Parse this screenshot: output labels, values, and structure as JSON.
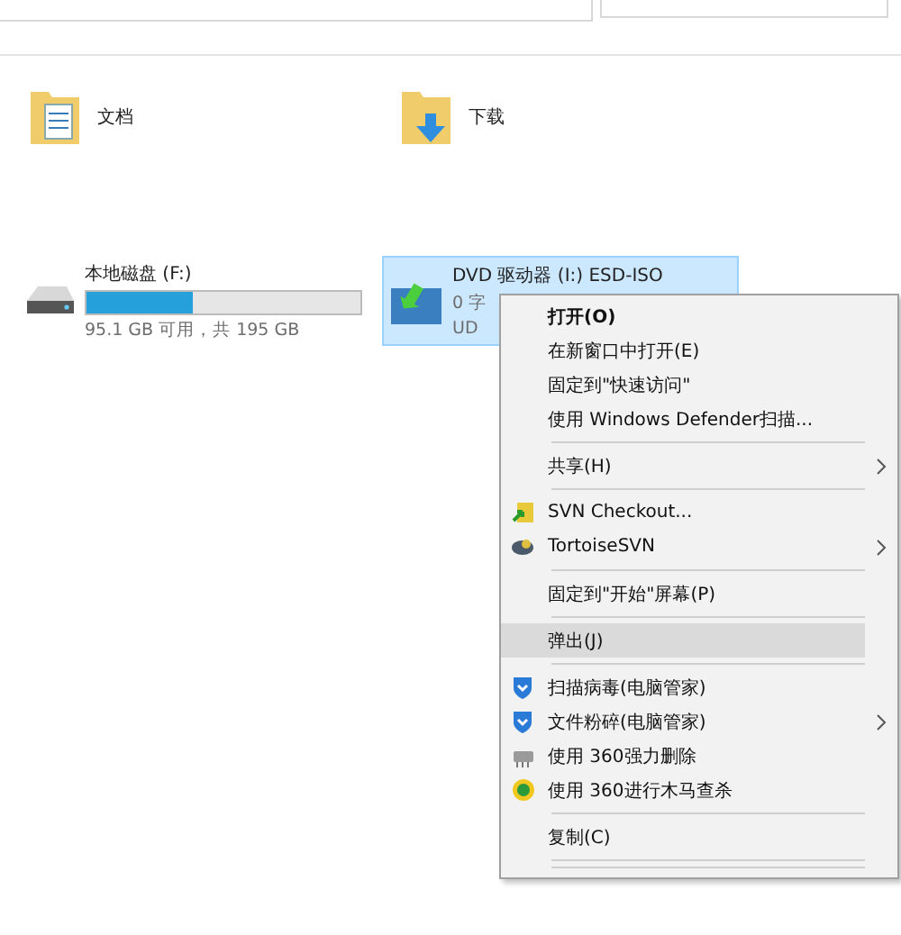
{
  "folders": [
    {
      "name": "文档",
      "kind": "documents"
    },
    {
      "name": "下载",
      "kind": "downloads"
    }
  ],
  "drives": [
    {
      "kind": "disk",
      "name": "本地磁盘 (F:)",
      "level": 0.39,
      "info": "95.1 GB 可用，共 195 GB",
      "selected": false
    },
    {
      "kind": "dvd",
      "name": "DVD 驱动器 (I:) ESD-ISO",
      "info": "0 字",
      "extra": "UD",
      "selected": true
    }
  ],
  "context_menu": [
    {
      "kind": "item",
      "label": "打开(O)",
      "bold": true,
      "selected": false
    },
    {
      "kind": "item",
      "label": "在新窗口中打开(E)",
      "selected": false
    },
    {
      "kind": "item",
      "label": "固定到\"快速访问\"",
      "selected": false
    },
    {
      "kind": "item",
      "label": "使用 Windows Defender扫描...",
      "selected": false
    },
    {
      "kind": "separator"
    },
    {
      "kind": "item",
      "label": "共享(H)",
      "submenu": true,
      "selected": false
    },
    {
      "kind": "separator"
    },
    {
      "kind": "svn",
      "label": "SVN Checkout...",
      "selected": false
    },
    {
      "kind": "tortoise",
      "label": "TortoiseSVN",
      "submenu": true,
      "selected": false
    },
    {
      "kind": "separator"
    },
    {
      "kind": "item",
      "label": "固定到\"开始\"屏幕(P)",
      "selected": false
    },
    {
      "kind": "separator"
    },
    {
      "kind": "item",
      "label": "弹出(J)",
      "selected": true
    },
    {
      "kind": "separator"
    },
    {
      "kind": "shield",
      "label": "扫描病毒(电脑管家)",
      "selected": false
    },
    {
      "kind": "shield",
      "label": "文件粉碎(电脑管家)",
      "submenu": true,
      "selected": false
    },
    {
      "kind": "shredder",
      "label": "使用 360强力删除",
      "selected": false
    },
    {
      "kind": "scan",
      "label": "使用 360进行木马查杀",
      "selected": false
    },
    {
      "kind": "separator"
    },
    {
      "kind": "item",
      "label": "复制(C)",
      "selected": false
    },
    {
      "kind": "separator"
    },
    {
      "kind": "separator"
    }
  ]
}
